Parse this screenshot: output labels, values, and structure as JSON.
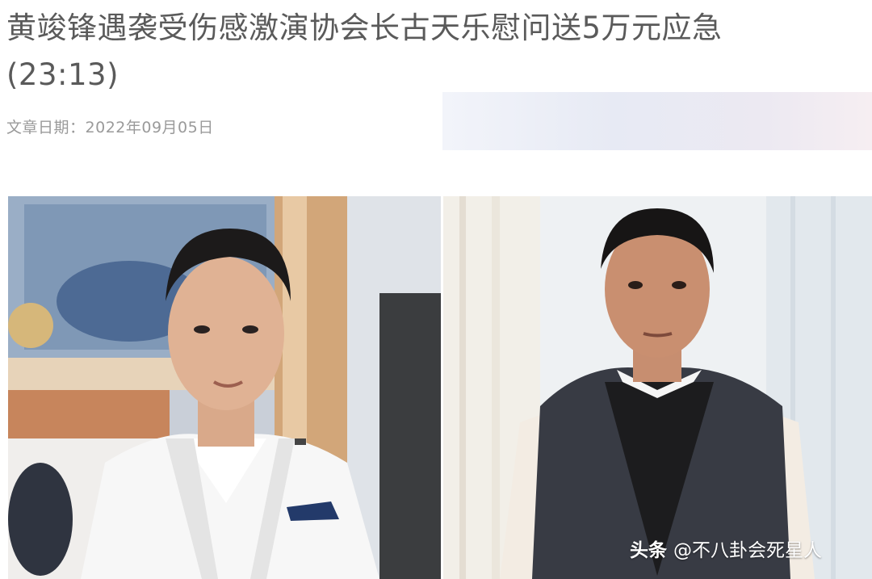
{
  "article": {
    "title": "黄竣锋遇袭受伤感激演协会长古天乐慰问送5万元应急(23:13)",
    "date_label": "文章日期：",
    "date_value": "2022年09月05日"
  },
  "watermark": {
    "brand": "头条",
    "handle": "@不八卦会死星人"
  },
  "images": {
    "left": "portrait-man-white-blazer",
    "right": "portrait-man-dark-vest"
  }
}
